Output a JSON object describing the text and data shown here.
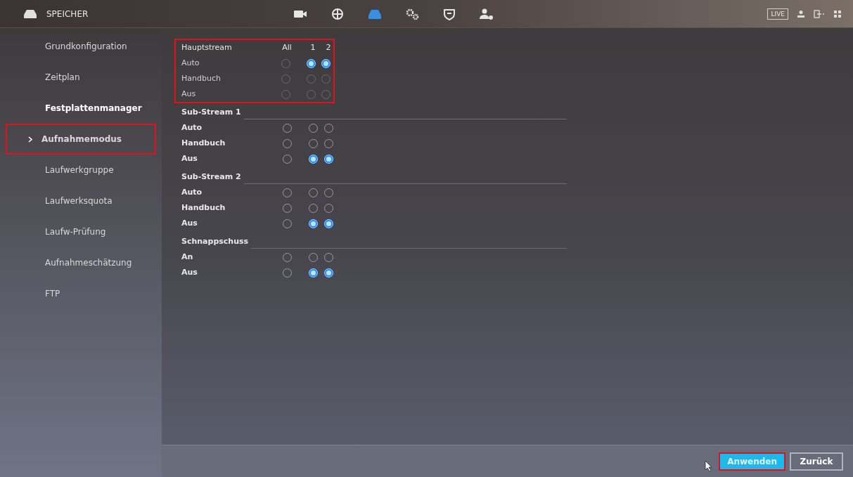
{
  "top_bar": {
    "title": "SPEICHER",
    "nav_icons": [
      {
        "kind": "camera",
        "selected": false
      },
      {
        "kind": "globe",
        "selected": false
      },
      {
        "kind": "storage",
        "selected": true
      },
      {
        "kind": "gears",
        "selected": false
      },
      {
        "kind": "shield",
        "selected": false
      },
      {
        "kind": "user-gear",
        "selected": false
      }
    ],
    "live_label": "LIVE"
  },
  "sidebar": {
    "items": [
      {
        "label": "Grundkonfiguration",
        "kind": "item",
        "selected": false,
        "highlighted": false
      },
      {
        "label": "Zeitplan",
        "kind": "item",
        "selected": false,
        "highlighted": false
      },
      {
        "label": "Festplattenmanager",
        "kind": "group",
        "selected": false,
        "highlighted": false
      },
      {
        "label": "Aufnahmemodus",
        "kind": "item",
        "selected": true,
        "highlighted": true
      },
      {
        "label": "Laufwerkgruppe",
        "kind": "item",
        "selected": false,
        "highlighted": false
      },
      {
        "label": "Laufwerksquota",
        "kind": "item",
        "selected": false,
        "highlighted": false
      },
      {
        "label": "Laufw-Prüfung",
        "kind": "item",
        "selected": false,
        "highlighted": false
      },
      {
        "label": "Aufnahmeschätzung",
        "kind": "item",
        "selected": false,
        "highlighted": false
      },
      {
        "label": "FTP",
        "kind": "item",
        "selected": false,
        "highlighted": false
      }
    ]
  },
  "columns": [
    "All",
    "1",
    "2"
  ],
  "sections": [
    {
      "title": "Hauptstream",
      "disabled": true,
      "highlighted": true,
      "rows": [
        {
          "label": "Auto",
          "options": [
            {
              "selected": false
            },
            {
              "selected": true
            },
            {
              "selected": true
            }
          ]
        },
        {
          "label": "Handbuch",
          "options": [
            {
              "selected": false
            },
            {
              "selected": false
            },
            {
              "selected": false
            }
          ]
        },
        {
          "label": "Aus",
          "options": [
            {
              "selected": false
            },
            {
              "selected": false
            },
            {
              "selected": false
            }
          ]
        }
      ]
    },
    {
      "title": "Sub-Stream 1",
      "disabled": false,
      "highlighted": false,
      "rows": [
        {
          "label": "Auto",
          "options": [
            {
              "selected": false
            },
            {
              "selected": false
            },
            {
              "selected": false
            }
          ]
        },
        {
          "label": "Handbuch",
          "options": [
            {
              "selected": false
            },
            {
              "selected": false
            },
            {
              "selected": false
            }
          ]
        },
        {
          "label": "Aus",
          "options": [
            {
              "selected": false
            },
            {
              "selected": true
            },
            {
              "selected": true
            }
          ]
        }
      ]
    },
    {
      "title": "Sub-Stream 2",
      "disabled": false,
      "highlighted": false,
      "rows": [
        {
          "label": "Auto",
          "options": [
            {
              "selected": false
            },
            {
              "selected": false
            },
            {
              "selected": false
            }
          ]
        },
        {
          "label": "Handbuch",
          "options": [
            {
              "selected": false
            },
            {
              "selected": false
            },
            {
              "selected": false
            }
          ]
        },
        {
          "label": "Aus",
          "options": [
            {
              "selected": false
            },
            {
              "selected": true
            },
            {
              "selected": true
            }
          ]
        }
      ]
    },
    {
      "title": "Schnappschuss",
      "disabled": false,
      "highlighted": false,
      "rows": [
        {
          "label": "An",
          "options": [
            {
              "selected": false
            },
            {
              "selected": false
            },
            {
              "selected": false
            }
          ]
        },
        {
          "label": "Aus",
          "options": [
            {
              "selected": false
            },
            {
              "selected": true
            },
            {
              "selected": true
            }
          ]
        }
      ]
    }
  ],
  "buttons": [
    {
      "label": "Anwenden",
      "kind": "primary",
      "highlighted": true
    },
    {
      "label": "Zurück",
      "kind": "secondary",
      "highlighted": false
    }
  ]
}
